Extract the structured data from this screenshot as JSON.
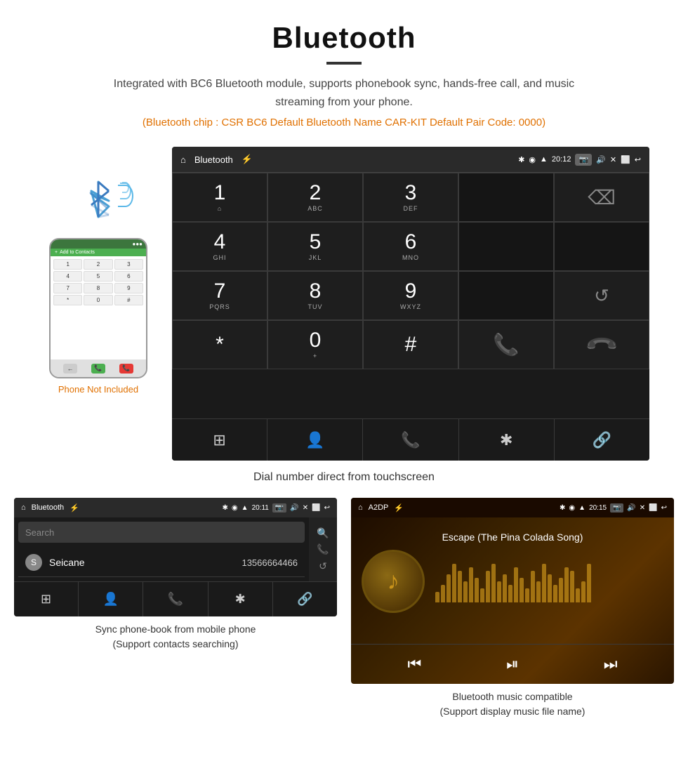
{
  "header": {
    "title": "Bluetooth",
    "description": "Integrated with BC6 Bluetooth module, supports phonebook sync, hands-free call, and music streaming from your phone.",
    "specs": "(Bluetooth chip : CSR BC6    Default Bluetooth Name CAR-KIT     Default Pair Code: 0000)",
    "divider_visible": true
  },
  "main_screen": {
    "status_bar": {
      "left": "🏠",
      "center": "Bluetooth",
      "usb_icon": "⚡",
      "time": "20:12",
      "icons": "✱ 📍 📶 🔋"
    },
    "dialpad": {
      "keys": [
        {
          "num": "1",
          "sub": "⌂"
        },
        {
          "num": "2",
          "sub": "ABC"
        },
        {
          "num": "3",
          "sub": "DEF"
        },
        {
          "num": "",
          "sub": ""
        },
        {
          "num": "⌫",
          "sub": ""
        },
        {
          "num": "4",
          "sub": "GHI"
        },
        {
          "num": "5",
          "sub": "JKL"
        },
        {
          "num": "6",
          "sub": "MNO"
        },
        {
          "num": "",
          "sub": ""
        },
        {
          "num": "",
          "sub": ""
        },
        {
          "num": "7",
          "sub": "PQRS"
        },
        {
          "num": "8",
          "sub": "TUV"
        },
        {
          "num": "9",
          "sub": "WXYZ"
        },
        {
          "num": "",
          "sub": ""
        },
        {
          "num": "↺",
          "sub": ""
        },
        {
          "num": "*",
          "sub": ""
        },
        {
          "num": "0",
          "sub": "+"
        },
        {
          "num": "#",
          "sub": ""
        },
        {
          "num": "📞",
          "sub": "green"
        },
        {
          "num": "📞",
          "sub": "red"
        }
      ],
      "bottom_nav": [
        "⊞",
        "👤",
        "📞",
        "✱",
        "🔗"
      ]
    }
  },
  "main_caption": "Dial number direct from touchscreen",
  "phone_side": {
    "label": "Phone Not Included"
  },
  "bottom_left": {
    "status": {
      "left": "🏠 Bluetooth ⚡",
      "time": "20:11",
      "right_icons": "✱ 📍 📶"
    },
    "search_placeholder": "Search",
    "contact": {
      "initial": "S",
      "name": "Seicane",
      "number": "13566664466"
    },
    "nav": [
      "⊞",
      "👤",
      "📞",
      "✱",
      "🔗"
    ],
    "caption_line1": "Sync phone-book from mobile phone",
    "caption_line2": "(Support contacts searching)"
  },
  "bottom_right": {
    "status": {
      "left": "🏠 A2DP ⚡",
      "time": "20:15",
      "right_icons": "✱ 📍 📶"
    },
    "song_title": "Escape (The Pina Colada Song)",
    "music_controls": [
      "⏮",
      "⏯",
      "⏭"
    ],
    "caption_line1": "Bluetooth music compatible",
    "caption_line2": "(Support display music file name)"
  },
  "icons": {
    "bluetooth": "✱",
    "phone_green": "📞",
    "phone_red": "📞",
    "backspace": "⌫",
    "refresh": "↺",
    "grid": "⊞",
    "person": "👤",
    "link": "🔗",
    "prev": "⏮",
    "play_pause": "⏯",
    "next": "⏭",
    "search": "🔍",
    "call": "📞",
    "sync": "↺"
  },
  "viz_heights": [
    15,
    25,
    40,
    55,
    45,
    30,
    50,
    35,
    20,
    45,
    55,
    30,
    40,
    25,
    50,
    35,
    20,
    45,
    30,
    55,
    40,
    25,
    35,
    50,
    45,
    20,
    30,
    55
  ]
}
